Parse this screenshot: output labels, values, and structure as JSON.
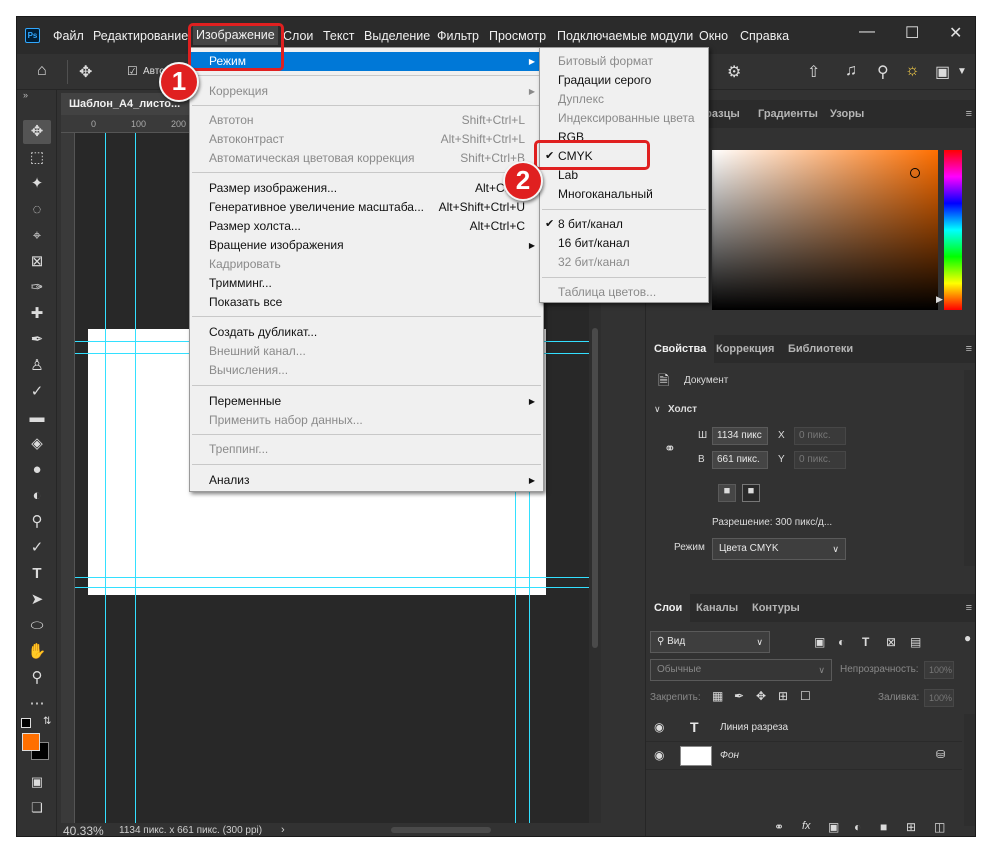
{
  "menubar": {
    "logo": "Ps",
    "items": [
      "Файл",
      "Редактирование",
      "Изображение",
      "Слои",
      "Текст",
      "Выделение",
      "Фильтр",
      "Просмотр",
      "Подключаемые модули",
      "Окно",
      "Справка"
    ],
    "active_item": "Изображение"
  },
  "optionsbar": {
    "auto_label": "Авто"
  },
  "document": {
    "tab_title": "Шаблон_А4_листо...",
    "ruler_ticks": [
      "0",
      "100",
      "200"
    ],
    "zoom": "40.33%",
    "status_info": "1134 пикс. x 661 пикс. (300 ppi)"
  },
  "image_menu": {
    "mode": {
      "label": "Режим"
    },
    "correction": {
      "label": "Коррекция"
    },
    "autotone": {
      "label": "Автотон",
      "shortcut": "Shift+Ctrl+L"
    },
    "autocontrast": {
      "label": "Автоконтраст",
      "shortcut": "Alt+Shift+Ctrl+L"
    },
    "autocolor": {
      "label": "Автоматическая цветовая коррекция",
      "shortcut": "Shift+Ctrl+B"
    },
    "image_size": {
      "label": "Размер изображения...",
      "shortcut": "Alt+Ctrl+I"
    },
    "generative_upscale": {
      "label": "Генеративное увеличение масштаба...",
      "shortcut": "Alt+Shift+Ctrl+U"
    },
    "canvas_size": {
      "label": "Размер холста...",
      "shortcut": "Alt+Ctrl+C"
    },
    "rotation": {
      "label": "Вращение изображения"
    },
    "crop": {
      "label": "Кадрировать"
    },
    "trim": {
      "label": "Тримминг..."
    },
    "reveal_all": {
      "label": "Показать все"
    },
    "duplicate": {
      "label": "Создать дубликат..."
    },
    "apply_image": {
      "label": "Внешний канал..."
    },
    "calculations": {
      "label": "Вычисления..."
    },
    "variables": {
      "label": "Переменные"
    },
    "apply_dataset": {
      "label": "Применить набор данных..."
    },
    "trap": {
      "label": "Треппинг..."
    },
    "analysis": {
      "label": "Анализ"
    }
  },
  "mode_submenu": {
    "bitmap": "Битовый формат",
    "grayscale": "Градации серого",
    "duotone": "Дуплекс",
    "indexed": "Индексированные цвета",
    "rgb": "RGB",
    "cmyk": "CMYK",
    "lab": "Lab",
    "multichannel": "Многоканальный",
    "bits8": "8 бит/канал",
    "bits16": "16 бит/канал",
    "bits32": "32 бит/канал",
    "color_table": "Таблица цветов...",
    "check": "✔"
  },
  "color_panel": {
    "tabs": [
      "...разцы",
      "Градиенты",
      "Узоры"
    ]
  },
  "properties_panel": {
    "tabs": [
      "Свойства",
      "Коррекция",
      "Библиотеки"
    ],
    "document_label": "Документ",
    "canvas_section": "Холст",
    "w_label": "Ш",
    "w_value": "1134 пикс",
    "h_label": "В",
    "h_value": "661 пикс.",
    "x_label": "X",
    "x_placeholder": "0 пикс.",
    "y_label": "Y",
    "y_placeholder": "0 пикс.",
    "resolution": "Разрешение: 300 пикс/д...",
    "mode_label": "Режим",
    "mode_value": "Цвета CMYK"
  },
  "layers_panel": {
    "tabs": [
      "Слои",
      "Каналы",
      "Контуры"
    ],
    "filter_value": "Вид",
    "blend_mode": "Обычные",
    "opacity_label": "Непрозрачность:",
    "opacity_value": "100%",
    "lock_label": "Закрепить:",
    "fill_label": "Заливка:",
    "fill_value": "100%",
    "layers": [
      {
        "name": "Линия разреза",
        "type": "T"
      },
      {
        "name": "Фон"
      }
    ]
  },
  "annotations": {
    "badge1": "1",
    "badge2": "2"
  },
  "colors": {
    "accent": "#e02020",
    "highlight": "#0078d7",
    "guides": "#33e0ff",
    "foreground": "#ff6f00"
  }
}
